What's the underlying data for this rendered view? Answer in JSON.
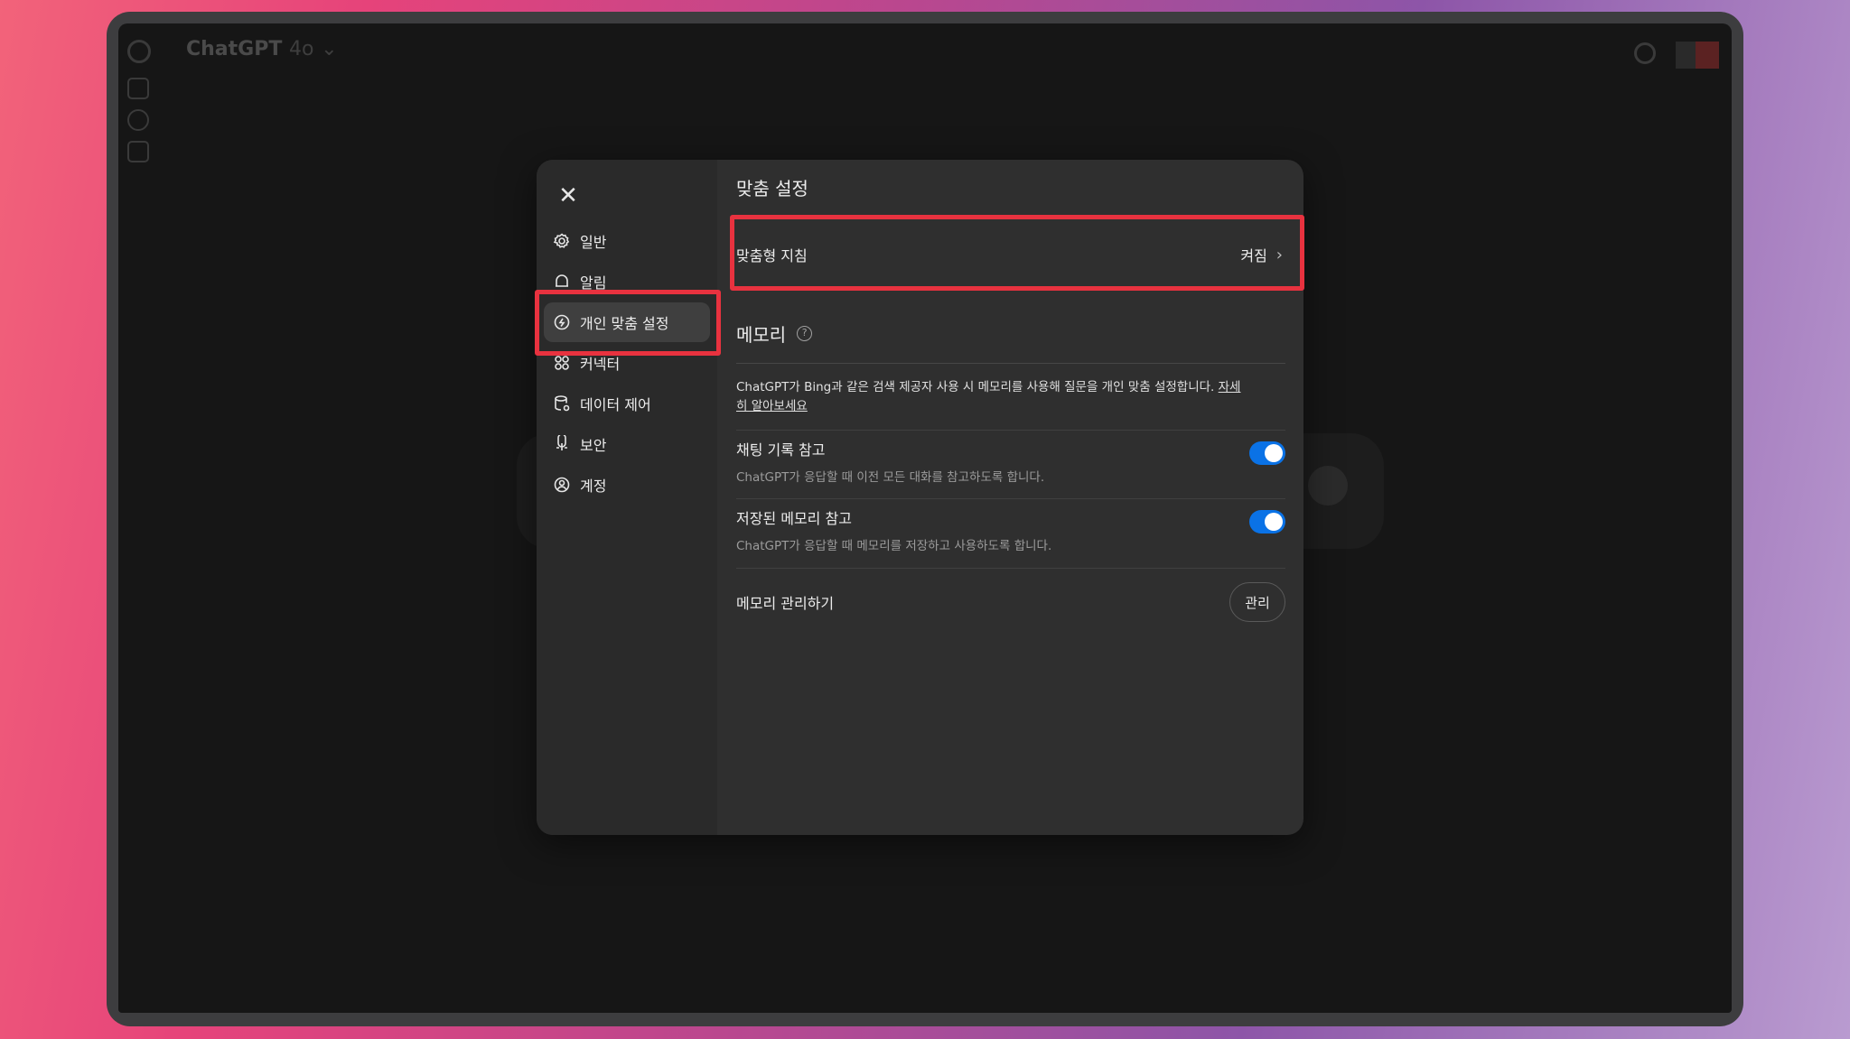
{
  "app": {
    "name": "ChatGPT",
    "model": "4o"
  },
  "modal": {
    "close_icon": "close-icon",
    "nav": [
      {
        "label": "일반",
        "icon": "gear-icon"
      },
      {
        "label": "알림",
        "icon": "bell-icon"
      },
      {
        "label": "개인 맞춤 설정",
        "icon": "personalization-icon",
        "active": true
      },
      {
        "label": "커넥터",
        "icon": "connector-icon"
      },
      {
        "label": "데이터 제어",
        "icon": "database-icon"
      },
      {
        "label": "보안",
        "icon": "shield-icon"
      },
      {
        "label": "계정",
        "icon": "account-icon"
      }
    ],
    "title": "맞춤 설정",
    "custom_instructions": {
      "label": "맞춤형 지침",
      "value": "켜짐"
    },
    "memory": {
      "title": "메모리",
      "help": "?",
      "desc": "ChatGPT가 Bing과 같은 검색 제공자 사용 시 메모리를 사용해 질문을 개인 맞춤 설정합니다.",
      "learn_more": "자세히 알아보세요",
      "toggles": [
        {
          "title": "채팅 기록 참고",
          "sub": "ChatGPT가 응답할 때 이전 모든 대화를 참고하도록 합니다.",
          "on": true
        },
        {
          "title": "저장된 메모리 참고",
          "sub": "ChatGPT가 응답할 때 메모리를 저장하고 사용하도록 합니다.",
          "on": true
        }
      ],
      "manage": {
        "label": "메모리 관리하기",
        "button": "관리"
      }
    }
  },
  "colors": {
    "highlight": "#e8323f",
    "toggle_on": "#0a72e6"
  }
}
